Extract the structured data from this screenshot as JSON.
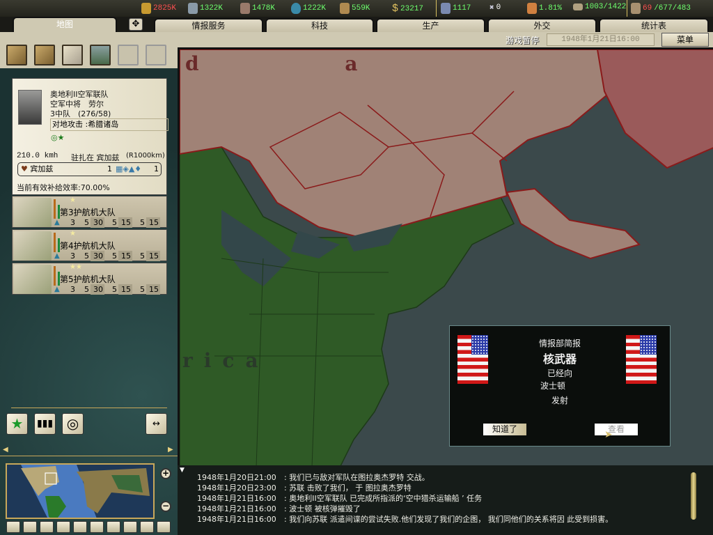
{
  "resources": [
    {
      "name": "energy",
      "value": "2825K",
      "color": "#ff5050"
    },
    {
      "name": "metal",
      "value": "1322K",
      "color": "#6eff6e"
    },
    {
      "name": "rare-materials",
      "value": "1478K",
      "color": "#6eff6e"
    },
    {
      "name": "oil",
      "value": "1222K",
      "color": "#6eff6e"
    },
    {
      "name": "supplies",
      "value": "559K",
      "color": "#6eff6e"
    },
    {
      "name": "money",
      "value": "23217",
      "color": "#6eff6e"
    },
    {
      "name": "manpower",
      "value": "1117",
      "color": "#6eff6e"
    },
    {
      "name": "nukes",
      "value": "0",
      "color": "#ffffff"
    },
    {
      "name": "dissent",
      "value": "1.81%",
      "color": "#6eff6e"
    },
    {
      "name": "transports",
      "value": "1003/1422",
      "color": "#6eff6e"
    },
    {
      "name": "ic",
      "value_red": "69",
      "value": "/677/483",
      "color": "#6eff6e"
    }
  ],
  "tabs": {
    "map": "地图",
    "intel": "情报服务",
    "tech": "科技",
    "production": "生产",
    "diplomacy": "外交",
    "stats": "统计表"
  },
  "status": {
    "paused": "游戏暂停",
    "date": "1948年1月21日16:00",
    "menu": "菜单"
  },
  "unit": {
    "name": "奥地利II空军联队",
    "commander": "空军中将　劳尔",
    "size": "3中队　(276/58)",
    "mission": "对地攻击 :希腊诸岛",
    "speed": "210.0 kmh",
    "stationed": "驻扎在 宾加兹",
    "range": "(R1000km)",
    "base": "宾加兹",
    "base_left": "1",
    "base_right": "1",
    "supply": "当前有效补给效率:70.00%"
  },
  "squadrons": [
    {
      "name": "第3护航机大队",
      "stars": "★",
      "stats": [
        "3",
        "5",
        "30",
        "5",
        "15",
        "5",
        "15"
      ]
    },
    {
      "name": "第4护航机大队",
      "stars": "★",
      "stats": [
        "3",
        "5",
        "30",
        "5",
        "15",
        "5",
        "15"
      ]
    },
    {
      "name": "第5护航机大队",
      "stars": "★★",
      "stats": [
        "3",
        "5",
        "30",
        "5",
        "15",
        "5",
        "15"
      ]
    }
  ],
  "map_labels": {
    "top_left": "d a",
    "bottom": "rica"
  },
  "popup": {
    "header": "情报部简报",
    "title": "核武器",
    "line1": "已经向",
    "line2": "波士顿",
    "line3": "发射",
    "ok": "知道了",
    "view": "查看"
  },
  "log": [
    {
      "date": "1948年1月20日21:00",
      "text": "我们已与敌对军队在图拉奥杰罗特 交战。"
    },
    {
      "date": "1948年1月20日23:00",
      "text": "苏联 击败了我们， 于 图拉奥杰罗特"
    },
    {
      "date": "1948年1月21日16:00",
      "text": "奥地利II空军联队 已完成所指派的‘空中猎杀运输船 ’ 任务"
    },
    {
      "date": "1948年1月21日16:00",
      "text": "波士顿 被核弹摧毁了"
    },
    {
      "date": "1948年1月21日16:00",
      "text": "我们向苏联 派遣间谍的尝试失败.他们发现了我们的企图， 我们同他们的关系将因 此受到损害。"
    }
  ]
}
